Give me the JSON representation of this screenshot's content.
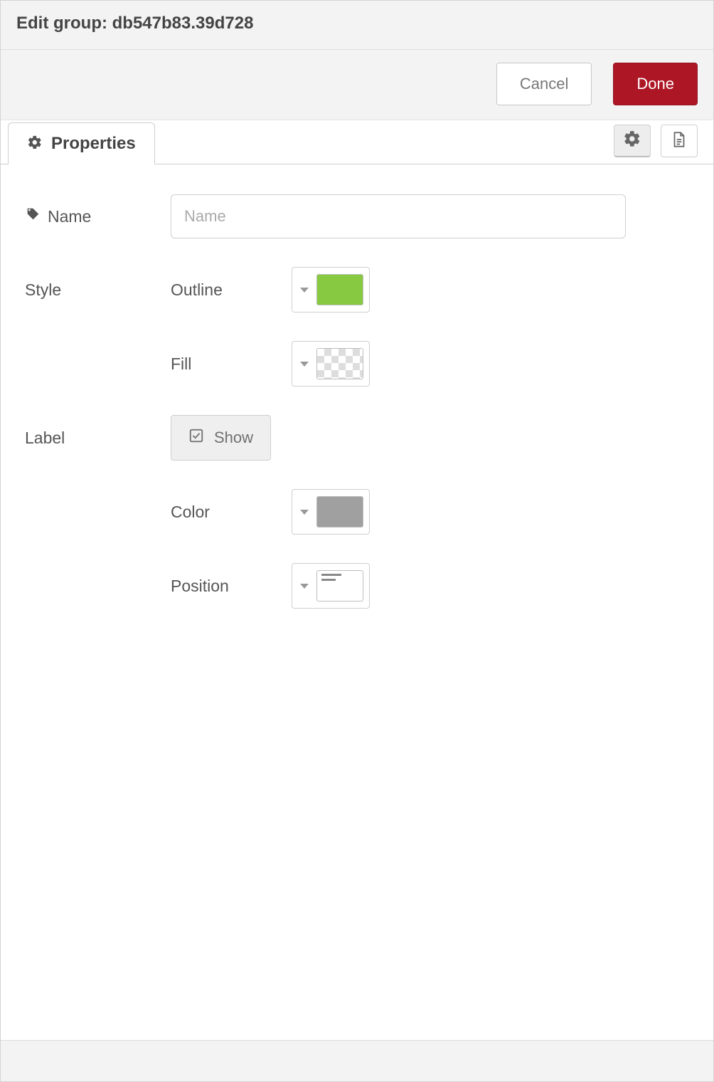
{
  "header": {
    "title": "Edit group: db547b83.39d728"
  },
  "buttons": {
    "cancel": "Cancel",
    "done": "Done"
  },
  "tabs": {
    "properties": "Properties"
  },
  "form": {
    "name_label": "Name",
    "name_placeholder": "Name",
    "name_value": "",
    "style_label": "Style",
    "outline_label": "Outline",
    "outline_color": "#87c940",
    "fill_label": "Fill",
    "fill_value": "transparent",
    "label_label": "Label",
    "show_label": "Show",
    "show_checked": true,
    "color_label": "Color",
    "label_color": "#a0a0a0",
    "position_label": "Position",
    "position_value": "nw"
  }
}
